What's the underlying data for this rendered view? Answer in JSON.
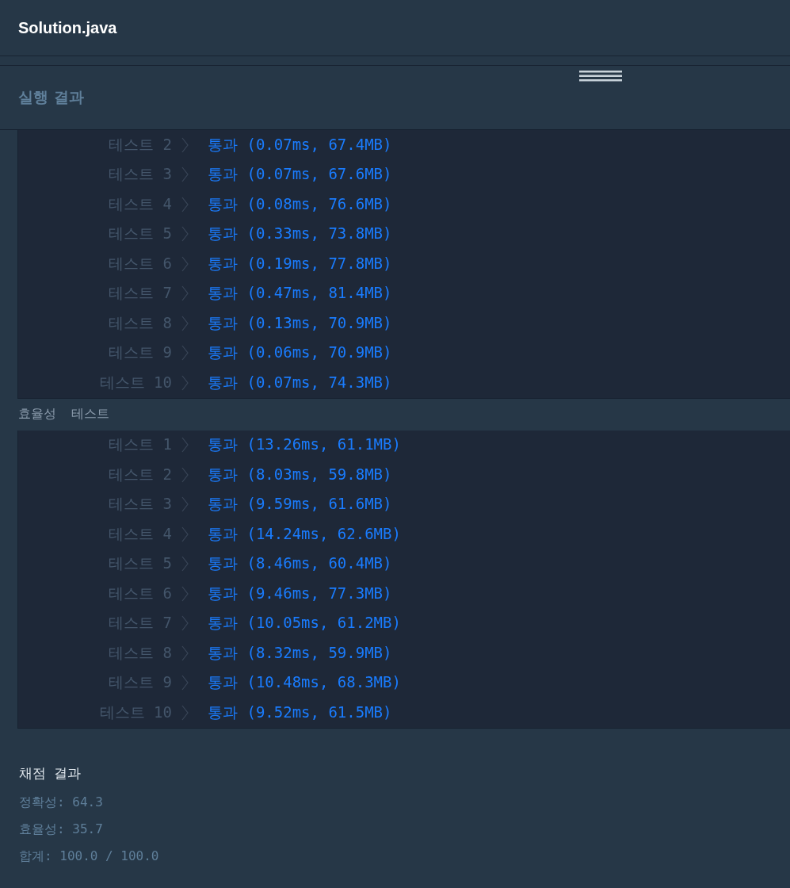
{
  "file_title": "Solution.java",
  "results_title": "실행 결과",
  "groups": [
    {
      "rows": [
        {
          "label": "테스트 2",
          "result": "통과 (0.07ms, 67.4MB)"
        },
        {
          "label": "테스트 3",
          "result": "통과 (0.07ms, 67.6MB)"
        },
        {
          "label": "테스트 4",
          "result": "통과 (0.08ms, 76.6MB)"
        },
        {
          "label": "테스트 5",
          "result": "통과 (0.33ms, 73.8MB)"
        },
        {
          "label": "테스트 6",
          "result": "통과 (0.19ms, 77.8MB)"
        },
        {
          "label": "테스트 7",
          "result": "통과 (0.47ms, 81.4MB)"
        },
        {
          "label": "테스트 8",
          "result": "통과 (0.13ms, 70.9MB)"
        },
        {
          "label": "테스트 9",
          "result": "통과 (0.06ms, 70.9MB)"
        },
        {
          "label": "테스트 10",
          "result": "통과 (0.07ms, 74.3MB)"
        }
      ]
    },
    {
      "heading": "효율성  테스트",
      "rows": [
        {
          "label": "테스트 1",
          "result": "통과 (13.26ms, 61.1MB)"
        },
        {
          "label": "테스트 2",
          "result": "통과 (8.03ms, 59.8MB)"
        },
        {
          "label": "테스트 3",
          "result": "통과 (9.59ms, 61.6MB)"
        },
        {
          "label": "테스트 4",
          "result": "통과 (14.24ms, 62.6MB)"
        },
        {
          "label": "테스트 5",
          "result": "통과 (8.46ms, 60.4MB)"
        },
        {
          "label": "테스트 6",
          "result": "통과 (9.46ms, 77.3MB)"
        },
        {
          "label": "테스트 7",
          "result": "통과 (10.05ms, 61.2MB)"
        },
        {
          "label": "테스트 8",
          "result": "통과 (8.32ms, 59.9MB)"
        },
        {
          "label": "테스트 9",
          "result": "통과 (10.48ms, 68.3MB)"
        },
        {
          "label": "테스트 10",
          "result": "통과 (9.52ms, 61.5MB)"
        }
      ]
    }
  ],
  "score": {
    "title": "채점 결과",
    "lines": [
      "정확성: 64.3",
      "효율성: 35.7",
      "합계: 100.0 / 100.0"
    ]
  }
}
